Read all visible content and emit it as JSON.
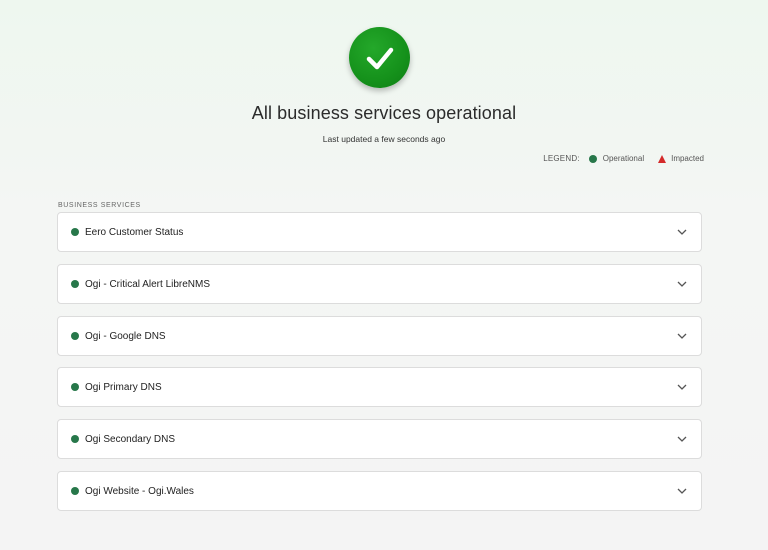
{
  "status": {
    "headline": "All business services operational",
    "last_updated": "Last updated a few seconds ago",
    "state": "operational",
    "icon": "check-icon",
    "color": "#15911b"
  },
  "legend": {
    "title": "LEGEND:",
    "items": [
      {
        "label": "Operational",
        "icon": "green-dot",
        "color": "#27774a"
      },
      {
        "label": "Impacted",
        "icon": "red-triangle",
        "color": "#d42a2a"
      }
    ]
  },
  "services_section": {
    "label": "BUSINESS SERVICES",
    "items": [
      {
        "name": "Eero Customer Status",
        "status": "operational"
      },
      {
        "name": "Ogi - Critical Alert LibreNMS",
        "status": "operational"
      },
      {
        "name": "Ogi - Google DNS",
        "status": "operational"
      },
      {
        "name": "Ogi Primary DNS",
        "status": "operational"
      },
      {
        "name": "Ogi Secondary DNS",
        "status": "operational"
      },
      {
        "name": "Ogi Website - Ogi.Wales",
        "status": "operational"
      }
    ]
  }
}
